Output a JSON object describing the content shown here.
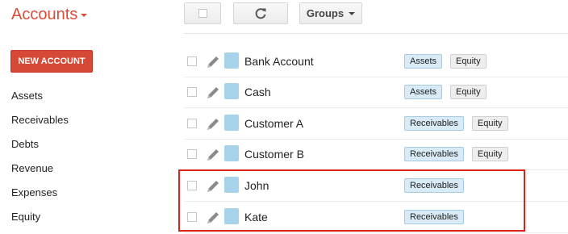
{
  "app": {
    "title": "Accounts"
  },
  "toolbar": {
    "groups_label": "Groups"
  },
  "sidebar": {
    "new_account_label": "NEW ACCOUNT",
    "items": [
      {
        "label": "Assets"
      },
      {
        "label": "Receivables"
      },
      {
        "label": "Debts"
      },
      {
        "label": "Revenue"
      },
      {
        "label": "Expenses"
      },
      {
        "label": "Equity"
      }
    ]
  },
  "accounts": [
    {
      "name": "Bank Account",
      "tags": [
        "Assets",
        "Equity"
      ]
    },
    {
      "name": "Cash",
      "tags": [
        "Assets",
        "Equity"
      ]
    },
    {
      "name": "Customer A",
      "tags": [
        "Receivables",
        "Equity"
      ]
    },
    {
      "name": "Customer B",
      "tags": [
        "Receivables",
        "Equity"
      ]
    },
    {
      "name": "John",
      "tags": [
        "Receivables"
      ]
    },
    {
      "name": "Kate",
      "tags": [
        "Receivables"
      ]
    }
  ],
  "colors": {
    "accent": "#dd4b39",
    "new_button": "#d64937",
    "swatch": "#a7d3ea",
    "highlight_border": "#e0211a"
  },
  "icons": {
    "title_dropdown": "caret-down-icon",
    "select_all": "checkbox-icon",
    "refresh": "refresh-icon",
    "groups_dropdown": "caret-down-icon",
    "edit": "pencil-icon"
  }
}
